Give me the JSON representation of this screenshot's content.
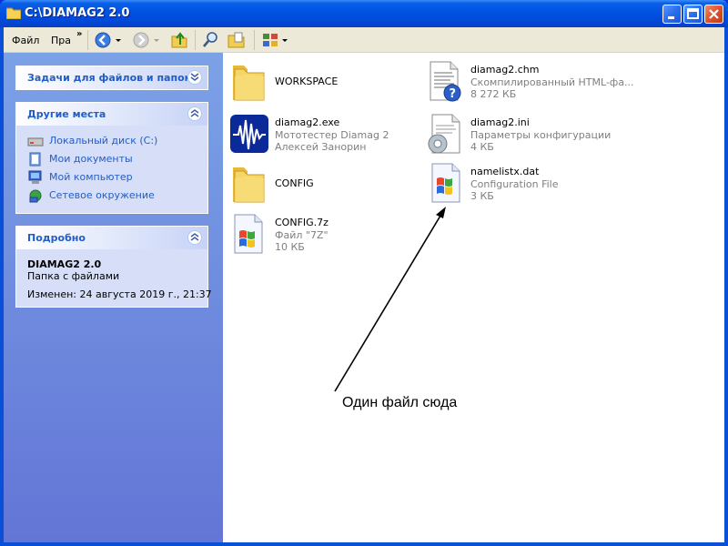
{
  "window": {
    "title": "C:\\DIAMAG2 2.0"
  },
  "menubar": {
    "file": "Файл",
    "edit_truncated": "Пра"
  },
  "taskpane": {
    "tasks": {
      "title": "Задачи для файлов и папок"
    },
    "places": {
      "title": "Другие места",
      "items": [
        "Локальный диск (C:)",
        "Мои документы",
        "Мой компьютер",
        "Сетевое окружение"
      ]
    },
    "details": {
      "title": "Подробно",
      "name": "DIAMAG2 2.0",
      "type": "Папка с файлами",
      "modified": "Изменен: 24 августа 2019 г., 21:37"
    }
  },
  "files": [
    {
      "name": "WORKSPACE",
      "desc1": "",
      "desc2": "",
      "icon": "folder-icon"
    },
    {
      "name": "diamag2.chm",
      "desc1": "Скомпилированный HTML-фа...",
      "desc2": "8 272 КБ",
      "icon": "help-file-icon"
    },
    {
      "name": "diamag2.exe",
      "desc1": "Мототестер Diamag 2",
      "desc2": "Алексей Занорин",
      "icon": "waveform-icon"
    },
    {
      "name": "diamag2.ini",
      "desc1": "Параметры конфигурации",
      "desc2": "4 КБ",
      "icon": "config-file-icon"
    },
    {
      "name": "CONFIG",
      "desc1": "",
      "desc2": "",
      "icon": "folder-icon"
    },
    {
      "name": "namelistx.dat",
      "desc1": "Configuration File",
      "desc2": "3 КБ",
      "icon": "windows-file-icon"
    },
    {
      "name": "CONFIG.7z",
      "desc1": "Файл \"7Z\"",
      "desc2": "10 КБ",
      "icon": "windows-file-icon"
    }
  ],
  "annotation": {
    "text": "Один файл сюда"
  }
}
